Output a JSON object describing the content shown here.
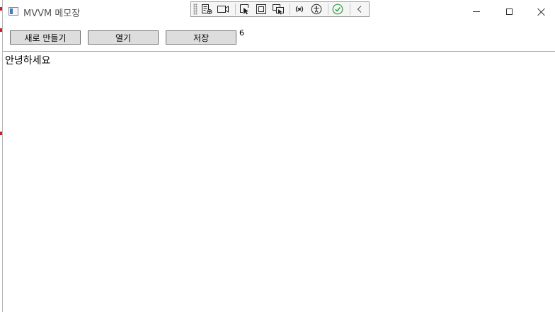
{
  "window": {
    "title": "MVVM 메모장"
  },
  "colors": {
    "button_face": "#dddddd",
    "button_border": "#707070",
    "check_green": "#2ea043"
  },
  "debug_toolbar": {
    "icons": [
      "live-visual-tree-icon",
      "record-icon",
      "select-element-icon",
      "display-layout-adorners-icon",
      "track-focus-icon",
      "binding-failures-icon",
      "accessibility-icon",
      "check-ok-icon",
      "collapse-chevron-icon"
    ]
  },
  "toolbar": {
    "new_label": "새로 만들기",
    "open_label": "열기",
    "save_label": "저장",
    "char_count": "6"
  },
  "editor": {
    "text": "안녕하세요"
  }
}
